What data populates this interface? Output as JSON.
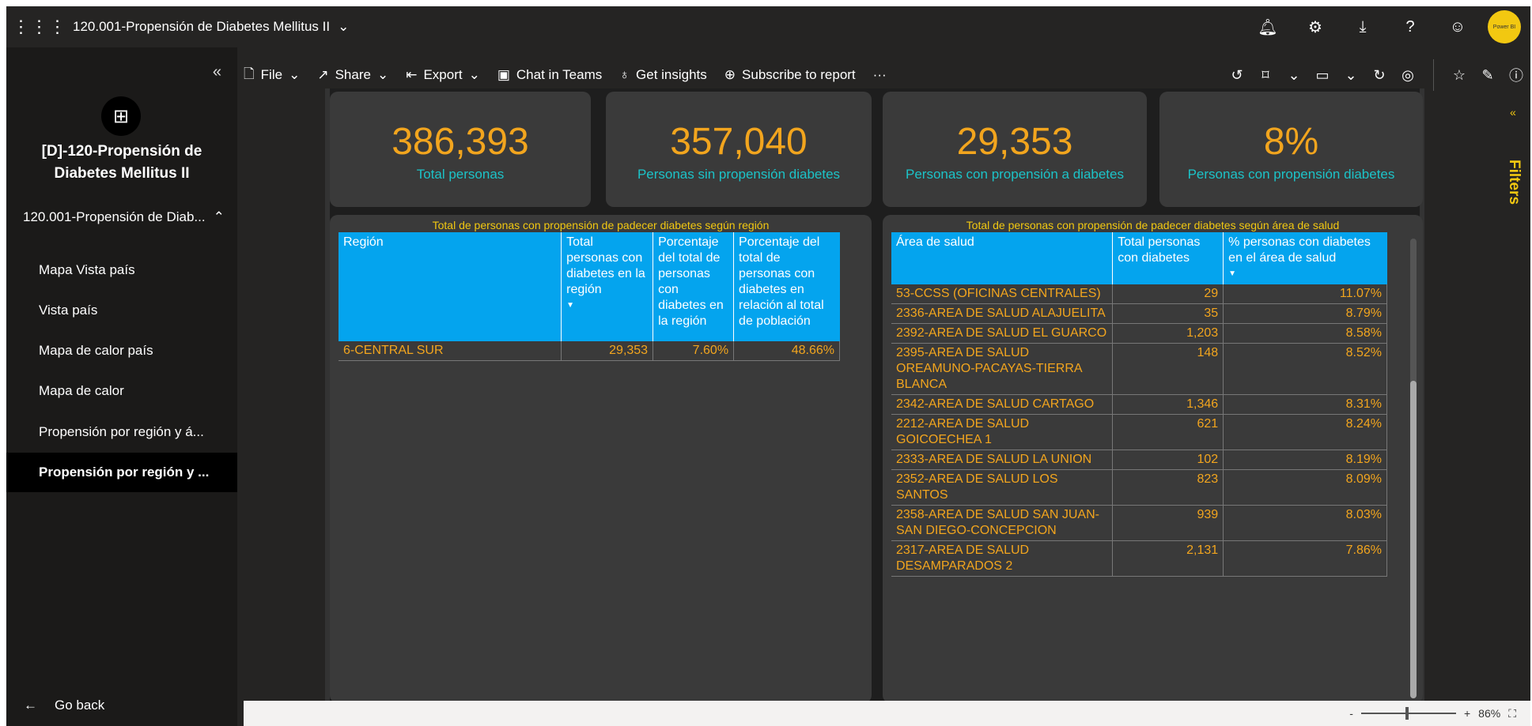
{
  "app": {
    "title": "120.001-Propensión de Diabetes Mellitus II",
    "avatar_text": "Power BI"
  },
  "nav": {
    "workspace_title_line1": "[D]-120-Propensión de",
    "workspace_title_line2": "Diabetes Mellitus II",
    "group": "120.001-Propensión de Diab...",
    "items": [
      {
        "label": "Mapa Vista país"
      },
      {
        "label": "Vista país"
      },
      {
        "label": "Mapa de calor país"
      },
      {
        "label": "Mapa de calor"
      },
      {
        "label": "Propensión por región y á..."
      },
      {
        "label": "Propensión por región y ..."
      }
    ],
    "go_back": "Go back"
  },
  "toolbar": {
    "file": "File",
    "share": "Share",
    "export": "Export",
    "chat": "Chat in Teams",
    "insights": "Get insights",
    "subscribe": "Subscribe to report",
    "more": "···"
  },
  "kpis": [
    {
      "value": "386,393",
      "label": "Total personas"
    },
    {
      "value": "357,040",
      "label": "Personas sin propensión diabetes"
    },
    {
      "value": "29,353",
      "label": "Personas con propensión a diabetes"
    },
    {
      "value": "8%",
      "label": "Personas con propensión diabetes"
    }
  ],
  "region_table": {
    "title": "Total de personas con propensión de padecer diabetes según región",
    "headers": [
      "Región",
      "Total personas con diabetes en la región",
      "Porcentaje del total de personas con diabetes en la región",
      "Porcentaje del total de personas con diabetes en relación al total de población"
    ],
    "rows": [
      [
        "6-CENTRAL SUR",
        "29,353",
        "7.60%",
        "48.66%"
      ]
    ]
  },
  "area_table": {
    "title": "Total de personas con propensión de padecer diabetes según área de salud",
    "headers": [
      "Área de salud",
      "Total personas con diabetes",
      "% personas con diabetes en el área de salud"
    ],
    "rows": [
      [
        "53-CCSS (OFICINAS CENTRALES)",
        "29",
        "11.07%"
      ],
      [
        "2336-AREA DE SALUD ALAJUELITA",
        "35",
        "8.79%"
      ],
      [
        "2392-AREA DE SALUD EL GUARCO",
        "1,203",
        "8.58%"
      ],
      [
        "2395-AREA DE SALUD OREAMUNO-PACAYAS-TIERRA BLANCA",
        "148",
        "8.52%"
      ],
      [
        "2342-AREA DE SALUD CARTAGO",
        "1,346",
        "8.31%"
      ],
      [
        "2212-AREA DE SALUD GOICOECHEA 1",
        "621",
        "8.24%"
      ],
      [
        "2333-AREA DE SALUD LA UNION",
        "102",
        "8.19%"
      ],
      [
        "2352-AREA DE SALUD LOS SANTOS",
        "823",
        "8.09%"
      ],
      [
        "2358-AREA DE SALUD SAN JUAN-SAN DIEGO-CONCEPCION",
        "939",
        "8.03%"
      ],
      [
        "2317-AREA DE SALUD DESAMPARADOS 2",
        "2,131",
        "7.86%"
      ]
    ]
  },
  "filters": {
    "label": "Filters"
  },
  "status": {
    "zoom": "86%",
    "minus": "-",
    "plus": "+"
  }
}
